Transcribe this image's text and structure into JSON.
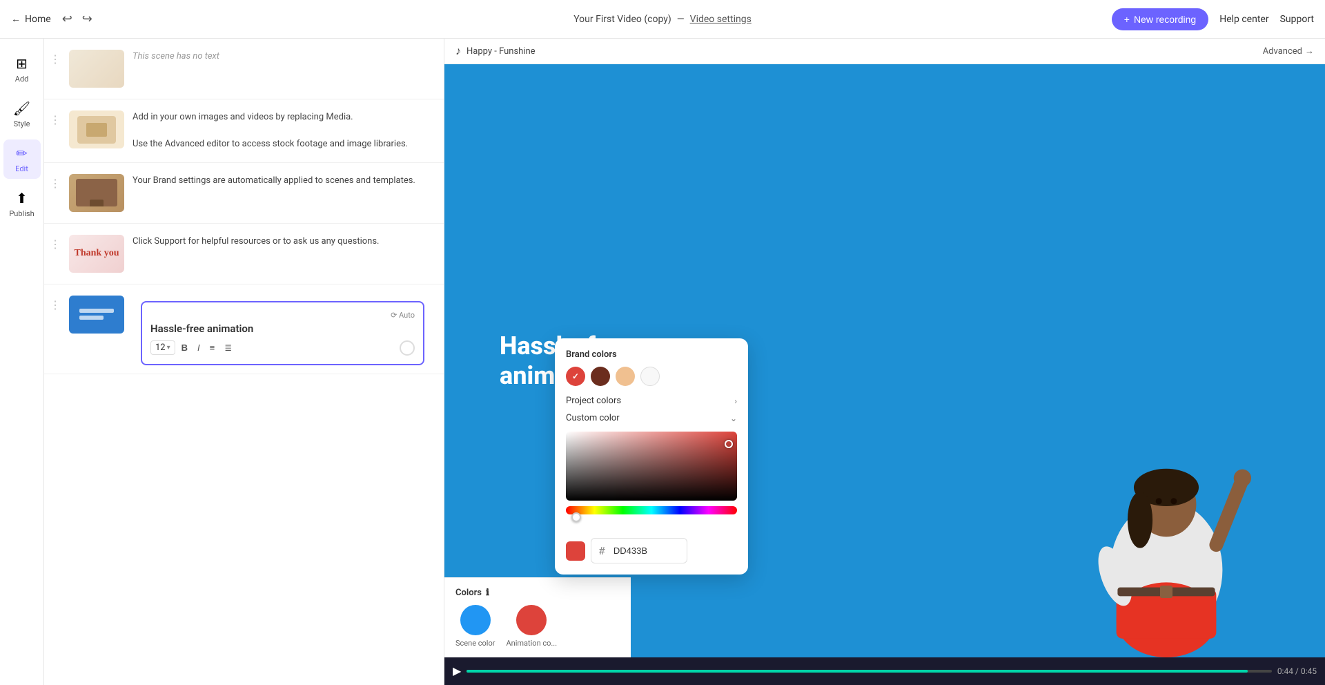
{
  "topbar": {
    "home_label": "Home",
    "title": "Your First Video (copy)",
    "separator": "—",
    "video_settings_label": "Video settings",
    "undo_icon": "↩",
    "redo_icon": "↪",
    "new_recording_label": "New recording",
    "new_recording_icon": "+",
    "help_center_label": "Help center",
    "support_label": "Support"
  },
  "sidebar": {
    "items": [
      {
        "id": "add",
        "icon": "⊞",
        "label": "Add"
      },
      {
        "id": "style",
        "icon": "🖌",
        "label": "Style"
      },
      {
        "id": "edit",
        "icon": "✏",
        "label": "Edit",
        "active": true
      },
      {
        "id": "publish",
        "icon": "↑",
        "label": "Publish"
      }
    ]
  },
  "music_bar": {
    "icon": "♪",
    "track": "Happy - Funshine",
    "advanced_label": "Advanced",
    "arrow": "→"
  },
  "scenes": [
    {
      "id": 1,
      "thumb_type": "grid",
      "text": null,
      "no_text_label": "This scene has no text"
    },
    {
      "id": 2,
      "thumb_type": "media",
      "text": "Add in your own images and videos by replacing Media.\n\nUse the Advanced editor to access stock footage and image libraries."
    },
    {
      "id": 3,
      "thumb_type": "brown",
      "text": "Your Brand settings are automatically applied to scenes and templates."
    },
    {
      "id": 4,
      "thumb_type": "thankyou",
      "text": "Click Support for helpful resources or to ask us any questions."
    },
    {
      "id": 5,
      "thumb_type": "blue",
      "text": "Hassle-free animation",
      "active": true
    }
  ],
  "text_editor": {
    "auto_label": "⟳ Auto",
    "title": "Hassle-free animation",
    "font_size": "12",
    "bold_label": "B",
    "italic_label": "I",
    "list_label": "≡",
    "ordered_label": "≣"
  },
  "video_preview": {
    "headline_line1": "Hassle-free",
    "headline_line2": "animation",
    "bg_color": "#1e90d4"
  },
  "color_popup": {
    "brand_colors_title": "Brand colors",
    "swatches": [
      {
        "color": "#dd433b",
        "selected": true
      },
      {
        "color": "#6B2D1E",
        "selected": false
      },
      {
        "color": "#f0c090",
        "selected": false
      },
      {
        "color": "#f8f8f8",
        "selected": false
      }
    ],
    "project_colors_label": "Project colors",
    "custom_color_label": "Custom color",
    "hex_value": "DD433B",
    "spectrum_left_pos": "8px"
  },
  "colors_section": {
    "title": "Colors",
    "info_icon": "ℹ",
    "scene_color_label": "Scene color",
    "scene_color_value": "#2196f3",
    "animation_color_label": "Animation co...",
    "animation_color_value": "#dd433b"
  },
  "video_controls": {
    "play_icon": "▶",
    "time_display": "0:44 / 0:45"
  }
}
